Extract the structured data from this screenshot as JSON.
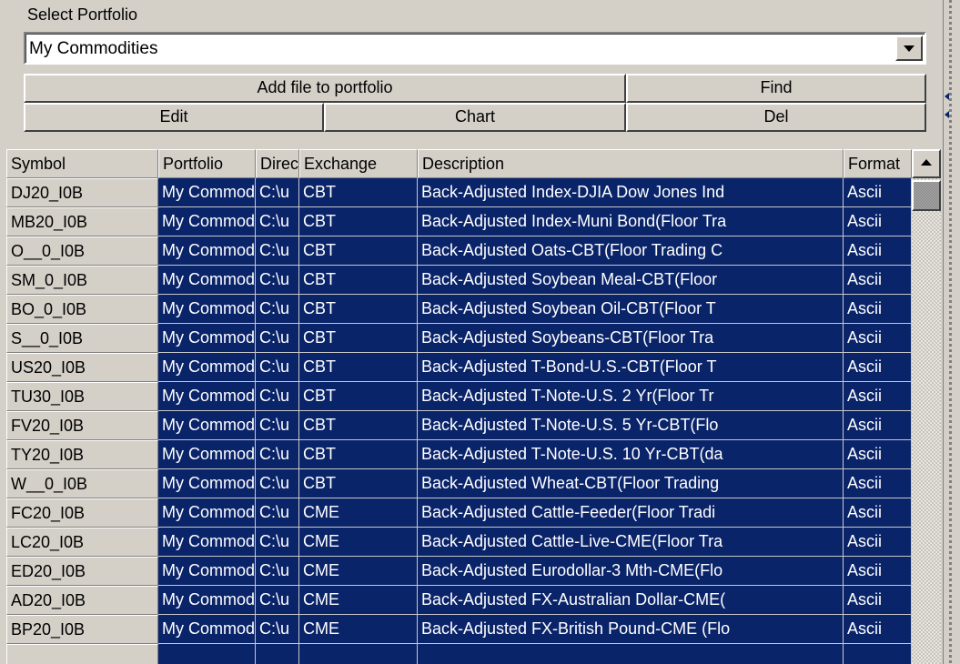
{
  "portfolio": {
    "label": "Select Portfolio",
    "selected": "My Commodities"
  },
  "buttons": {
    "add_file": "Add file to portfolio",
    "find": "Find",
    "edit": "Edit",
    "chart": "Chart",
    "del": "Del"
  },
  "table": {
    "columns": [
      "Symbol",
      "Portfolio",
      "Directory",
      "Exchange",
      "Description",
      "Format"
    ],
    "rows": [
      {
        "symbol": "DJ20_I0B",
        "portfolio": "My Commodities",
        "directory": "C:\\u",
        "exchange": "CBT",
        "description": "Back-Adjusted Index-DJIA Dow Jones Ind",
        "format": "Ascii"
      },
      {
        "symbol": "MB20_I0B",
        "portfolio": "My Commodities",
        "directory": "C:\\u",
        "exchange": "CBT",
        "description": "Back-Adjusted Index-Muni Bond(Floor Tra",
        "format": "Ascii"
      },
      {
        "symbol": "O__0_I0B",
        "portfolio": "My Commodities",
        "directory": "C:\\u",
        "exchange": "CBT",
        "description": "Back-Adjusted Oats-CBT(Floor Trading C",
        "format": "Ascii"
      },
      {
        "symbol": "SM_0_I0B",
        "portfolio": "My Commodities",
        "directory": "C:\\u",
        "exchange": "CBT",
        "description": "Back-Adjusted Soybean Meal-CBT(Floor",
        "format": "Ascii"
      },
      {
        "symbol": "BO_0_I0B",
        "portfolio": "My Commodities",
        "directory": "C:\\u",
        "exchange": "CBT",
        "description": "Back-Adjusted Soybean Oil-CBT(Floor T",
        "format": "Ascii"
      },
      {
        "symbol": "S__0_I0B",
        "portfolio": "My Commodities",
        "directory": "C:\\u",
        "exchange": "CBT",
        "description": "Back-Adjusted Soybeans-CBT(Floor Tra",
        "format": "Ascii"
      },
      {
        "symbol": "US20_I0B",
        "portfolio": "My Commodities",
        "directory": "C:\\u",
        "exchange": "CBT",
        "description": "Back-Adjusted T-Bond-U.S.-CBT(Floor T",
        "format": "Ascii"
      },
      {
        "symbol": "TU30_I0B",
        "portfolio": "My Commodities",
        "directory": "C:\\u",
        "exchange": "CBT",
        "description": "Back-Adjusted T-Note-U.S.  2 Yr(Floor Tr",
        "format": "Ascii"
      },
      {
        "symbol": "FV20_I0B",
        "portfolio": "My Commodities",
        "directory": "C:\\u",
        "exchange": "CBT",
        "description": "Back-Adjusted T-Note-U.S.  5 Yr-CBT(Flo",
        "format": "Ascii"
      },
      {
        "symbol": "TY20_I0B",
        "portfolio": "My Commodities",
        "directory": "C:\\u",
        "exchange": "CBT",
        "description": "Back-Adjusted T-Note-U.S. 10 Yr-CBT(da",
        "format": "Ascii"
      },
      {
        "symbol": "W__0_I0B",
        "portfolio": "My Commodities",
        "directory": "C:\\u",
        "exchange": "CBT",
        "description": "Back-Adjusted Wheat-CBT(Floor Trading",
        "format": "Ascii"
      },
      {
        "symbol": "FC20_I0B",
        "portfolio": "My Commodities",
        "directory": "C:\\u",
        "exchange": "CME",
        "description": "Back-Adjusted Cattle-Feeder(Floor Tradi",
        "format": "Ascii"
      },
      {
        "symbol": "LC20_I0B",
        "portfolio": "My Commodities",
        "directory": "C:\\u",
        "exchange": "CME",
        "description": "Back-Adjusted Cattle-Live-CME(Floor Tra",
        "format": "Ascii"
      },
      {
        "symbol": "ED20_I0B",
        "portfolio": "My Commodities",
        "directory": "C:\\u",
        "exchange": "CME",
        "description": "Back-Adjusted Eurodollar-3 Mth-CME(Flo",
        "format": "Ascii"
      },
      {
        "symbol": "AD20_I0B",
        "portfolio": "My Commodities",
        "directory": "C:\\u",
        "exchange": "CME",
        "description": "Back-Adjusted FX-Australian Dollar-CME(",
        "format": "Ascii"
      },
      {
        "symbol": "BP20_I0B",
        "portfolio": "My Commodities",
        "directory": "C:\\u",
        "exchange": "CME",
        "description": "Back-Adjusted FX-British Pound-CME (Flo",
        "format": "Ascii"
      },
      {
        "symbol": "",
        "portfolio": "",
        "directory": "",
        "exchange": "",
        "description": "",
        "format": ""
      }
    ]
  },
  "colors": {
    "face": "#d4d0c8",
    "selection": "#0a246a",
    "selection_text": "#ffffff"
  }
}
